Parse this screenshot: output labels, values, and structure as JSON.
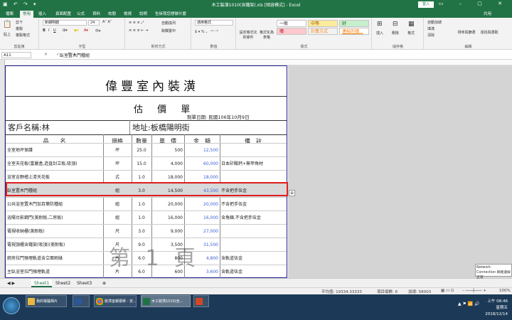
{
  "window": {
    "title": "木工裝潢1010(含鐵架).xls [相容模式] - Excel",
    "login": "登入"
  },
  "ribbon_tabs": [
    "檔案",
    "常用",
    "插入",
    "頁面配置",
    "公式",
    "資料",
    "校閱",
    "檢視",
    "說明",
    "告訴我您想做什麼",
    "共用"
  ],
  "ribbon": {
    "clipboard": {
      "paste": "貼上",
      "cut": "剪下",
      "copy": "複製",
      "painter": "複製格式",
      "label": "剪貼簿"
    },
    "font": {
      "name": "新細明體",
      "size": "24",
      "label": "字型"
    },
    "align": {
      "wrap": "自動換列",
      "merge": "跨欄置中",
      "label": "對齊方式"
    },
    "number": {
      "format": "通用格式",
      "label": "數值"
    },
    "styles": {
      "cond": "設定格式化的條件",
      "table": "格式化為表格",
      "general": "一般",
      "bad": "壞",
      "neutral": "中等",
      "calc": "計算方式",
      "good": "好",
      "link": "連結的儲...",
      "label": "樣式"
    },
    "cells": {
      "insert": "插入",
      "delete": "刪除",
      "format": "格式",
      "label": "儲存格"
    },
    "edit": {
      "autosum": "自動加總",
      "fill": "填滿",
      "clear": "清除",
      "sort": "排序與篩選",
      "find": "尋找與選取",
      "label": "編輯"
    }
  },
  "formula": {
    "namebox": "A11",
    "content": "臥室置木門種組"
  },
  "sheet": {
    "company": "偉豐室內裝潢",
    "subtitle": "估 價 單",
    "date": "制單日期: 民國106年10月9日",
    "customer": "客戶名稱:林",
    "address": "地址:板橋陽明街",
    "headers": [
      "品　　名",
      "規格",
      "數量",
      "單　價",
      "金　額",
      "備　註"
    ],
    "rows": [
      {
        "name": "全室地坪保護",
        "unit": "坪",
        "qty": "25.0",
        "price": "500",
        "amount": "12,500",
        "note": ""
      },
      {
        "name": "全室天花板(富麗盒,造直封立板,吸頂)",
        "unit": "坪",
        "qty": "15.0",
        "price": "4,000",
        "amount": "60,000",
        "note": "日本矽酸鈣+無甲角材"
      },
      {
        "name": "浴室吉野檜上漆天花板",
        "unit": "式",
        "qty": "1.0",
        "price": "18,000",
        "amount": "18,000",
        "note": ""
      },
      {
        "name": "臥室置木門種組",
        "unit": "組",
        "qty": "3.0",
        "price": "14,500",
        "amount": "43,500",
        "note": "不含把手伍金"
      },
      {
        "name": "公共浴室置木門加百葉防種組",
        "unit": "組",
        "qty": "1.0",
        "price": "20,000",
        "amount": "20,000",
        "note": "不含把手伍金"
      },
      {
        "name": "浴陽台影鋼門(美耐板,二房板)",
        "unit": "組",
        "qty": "1.0",
        "price": "16,000",
        "amount": "16,000",
        "note": "含角鍊,不含把手伍金"
      },
      {
        "name": "電視收納櫃(美耐板)",
        "unit": "尺",
        "qty": "3.0",
        "price": "9,000",
        "amount": "27,000",
        "note": ""
      },
      {
        "name": "電視頂櫃含鐵架(吸頂)(美耐板)",
        "unit": "尺",
        "qty": "9.0",
        "price": "3,500",
        "amount": "31,500",
        "note": ""
      },
      {
        "name": "廚房拉門預埋軌道含立面刷綠",
        "unit": "片",
        "qty": "6.0",
        "price": "800",
        "amount": "4,800",
        "note": "含軌道伍金"
      },
      {
        "name": "主臥浴室拉門預埋軌道",
        "unit": "片",
        "qty": "6.0",
        "price": "600",
        "amount": "3,600",
        "note": "含軌道伍金"
      }
    ],
    "watermark": "第 1 頁"
  },
  "sheet_tabs": [
    "Sheet1",
    "Sheet2",
    "Sheet3"
  ],
  "status": {
    "avg": "平均值: 19334.33333",
    "count": "項目個數: 6",
    "sum": "加總: 58003",
    "zoom": "100%"
  },
  "taskbar": {
    "items": [
      "我的電腦相片",
      "裝潢室報價單 - 安...",
      "木工裝潢1010(含...",
      ""
    ],
    "time": "上午 08:46",
    "day": "星期五",
    "date": "2018/12/14",
    "tooltip": "Network Connection 網路連線正常"
  },
  "colors": {
    "excel_green": "#217346",
    "blue_amount": "#3a5fd9",
    "red_box": "#e02020"
  }
}
